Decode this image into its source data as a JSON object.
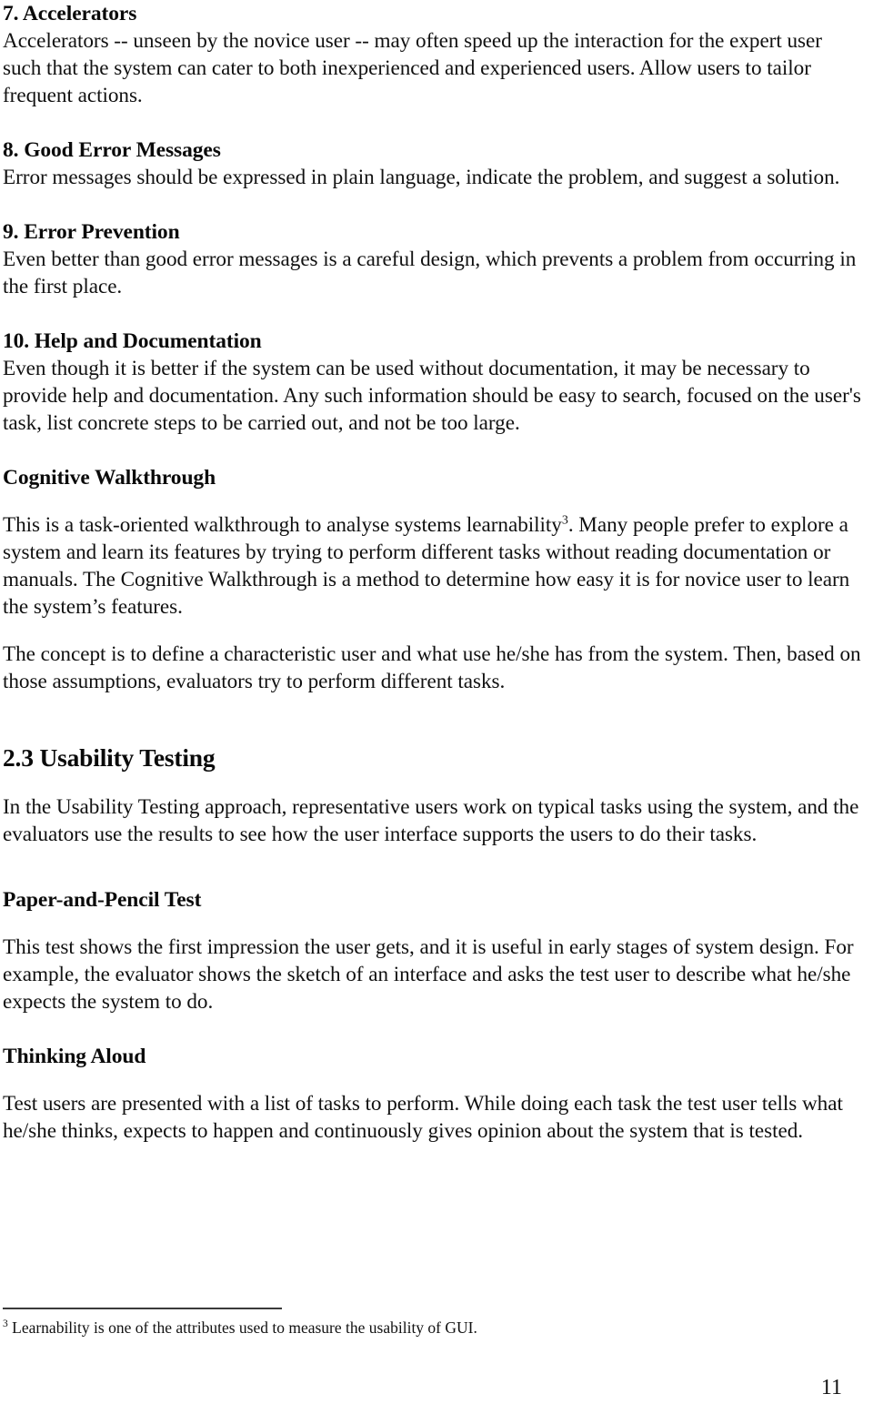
{
  "document": {
    "page_number": "11",
    "blocks": [
      {
        "kind": "heading",
        "name": "heading-accelerators",
        "text": "7. Accelerators"
      },
      {
        "kind": "paragraph",
        "name": "paragraph-accelerators",
        "text": "Accelerators -- unseen by the novice user -- may often speed up the interaction for the expert user such that the system can cater to both inexperienced and experienced users. Allow users to tailor frequent actions."
      },
      {
        "kind": "heading",
        "name": "heading-good-error-messages",
        "text": "8. Good Error Messages"
      },
      {
        "kind": "paragraph",
        "name": "paragraph-good-error-messages",
        "text": "Error messages should be expressed in plain language, indicate the problem, and suggest a solution."
      },
      {
        "kind": "heading",
        "name": "heading-error-prevention",
        "text": "9. Error Prevention"
      },
      {
        "kind": "paragraph",
        "name": "paragraph-error-prevention",
        "text": "Even better than good error messages is a careful design, which prevents a problem from occurring in the first place."
      },
      {
        "kind": "heading",
        "name": "heading-help-and-documentation",
        "text": "10. Help and Documentation"
      },
      {
        "kind": "paragraph",
        "name": "paragraph-help-and-documentation",
        "text": "Even though it is better if the system can be used without documentation, it may be necessary to provide help and documentation. Any such information should be easy to search, focused on the user's task, list concrete steps to be carried out, and not be too large."
      },
      {
        "kind": "heading",
        "name": "heading-cognitive-walkthrough",
        "text": "Cognitive Walkthrough"
      },
      {
        "kind": "paragraph-with-footnote",
        "name": "paragraph-cognitive-walkthrough-1",
        "text_before_ref": "This is a task-oriented walkthrough to analyse systems learnability",
        "footnote_ref": "3",
        "text_after_ref": ". Many people prefer to explore a system and learn its features by trying to perform different tasks without reading documentation or manuals. The Cognitive Walkthrough is a method to determine how easy it is for novice user to learn the system’s features."
      },
      {
        "kind": "paragraph",
        "name": "paragraph-cognitive-walkthrough-2",
        "text": "The concept is to define a characteristic user and what use he/she has from the system. Then, based on those assumptions, evaluators try to perform different tasks."
      },
      {
        "kind": "section-heading",
        "name": "heading-usability-testing",
        "text": "2.3 Usability Testing"
      },
      {
        "kind": "paragraph",
        "name": "paragraph-usability-testing",
        "text": "In the Usability Testing approach, representative users work on typical tasks using the system, and the evaluators use the results to see how the user interface supports the users to do their tasks."
      },
      {
        "kind": "heading",
        "name": "heading-paper-and-pencil-test",
        "text": "Paper-and-Pencil Test"
      },
      {
        "kind": "paragraph",
        "name": "paragraph-paper-and-pencil-test",
        "text": "This test shows the first impression the user gets, and it is useful in early stages of system design. For example, the evaluator shows the sketch of an interface and asks the test user to describe what he/she expects the system to do."
      },
      {
        "kind": "heading",
        "name": "heading-thinking-aloud",
        "text": "Thinking Aloud"
      },
      {
        "kind": "paragraph",
        "name": "paragraph-thinking-aloud",
        "text": "Test users are presented with a list of tasks to perform. While doing each task the test user tells what he/she thinks, expects to happen and continuously gives opinion about the system that is tested."
      }
    ],
    "footnote": {
      "marker": "3",
      "text": "Learnability is one of the attributes used to measure the usability of GUI."
    }
  }
}
